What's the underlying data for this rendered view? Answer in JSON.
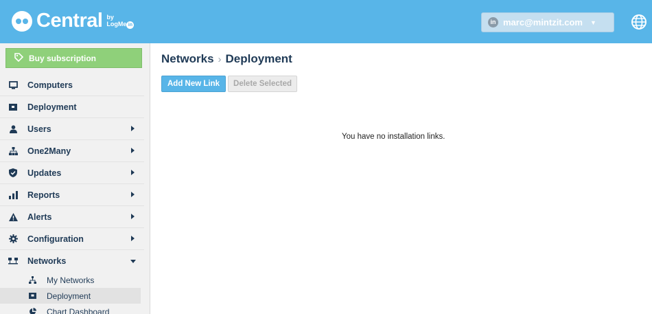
{
  "app": {
    "brand": "Central",
    "brand_by": "by",
    "brand_logmein": "LogMe",
    "brand_in": "in"
  },
  "header": {
    "user_avatar": "in",
    "user_email": "marc@mintzit.com",
    "user_caret": "▼",
    "globe_icon": "globe-icon"
  },
  "sidebar": {
    "buy_label": "Buy subscription",
    "items": [
      {
        "label": "Computers",
        "icon": "monitor-icon",
        "has_arrow": false
      },
      {
        "label": "Deployment",
        "icon": "deployment-icon",
        "has_arrow": false
      },
      {
        "label": "Users",
        "icon": "user-icon",
        "has_arrow": true
      },
      {
        "label": "One2Many",
        "icon": "hierarchy-icon",
        "has_arrow": true
      },
      {
        "label": "Updates",
        "icon": "shield-icon",
        "has_arrow": true
      },
      {
        "label": "Reports",
        "icon": "bar-chart-icon",
        "has_arrow": true
      },
      {
        "label": "Alerts",
        "icon": "warning-icon",
        "has_arrow": true
      },
      {
        "label": "Configuration",
        "icon": "gear-icon",
        "has_arrow": true
      },
      {
        "label": "Networks",
        "icon": "network-icon",
        "has_arrow": true,
        "expanded": true
      }
    ],
    "sub_items": [
      {
        "label": "My Networks",
        "icon": "network-tree-icon"
      },
      {
        "label": "Deployment",
        "icon": "deployment-icon",
        "active": true
      },
      {
        "label": "Chart Dashboard",
        "icon": "pie-chart-icon"
      }
    ]
  },
  "main": {
    "breadcrumb_parent": "Networks",
    "breadcrumb_sep": "›",
    "breadcrumb_current": "Deployment",
    "add_button": "Add New Link",
    "delete_button": "Delete Selected",
    "empty_message": "You have no installation links."
  },
  "colors": {
    "header": "#58b5e8",
    "buy": "#8fd07a",
    "nav_text": "#1f3a56"
  }
}
